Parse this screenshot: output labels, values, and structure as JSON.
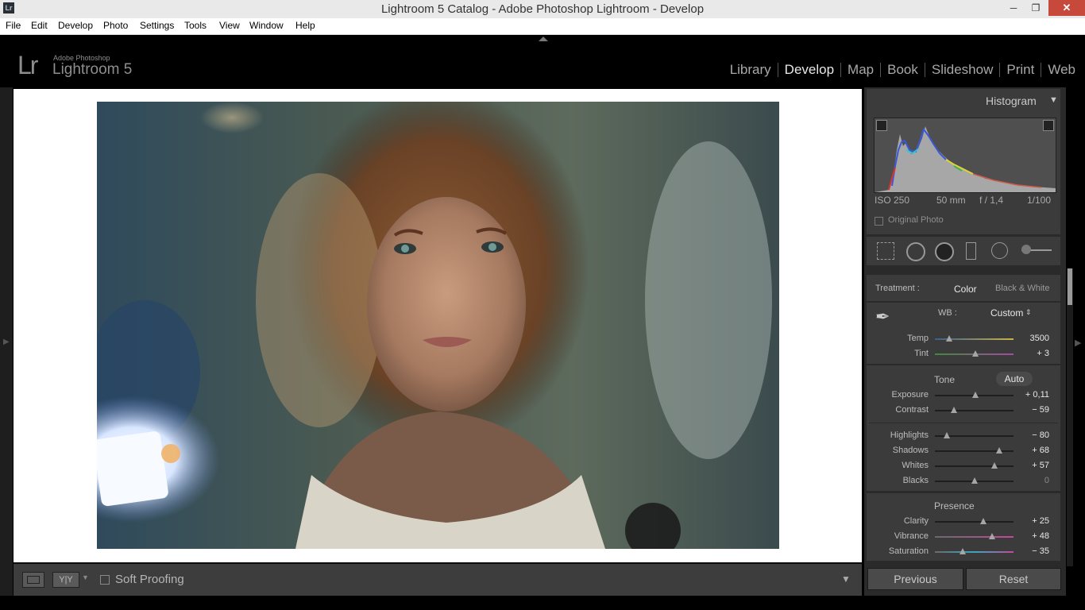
{
  "window": {
    "title": "Lightroom 5 Catalog - Adobe Photoshop Lightroom - Develop",
    "app_icon_text": "Lr",
    "minimize": "─",
    "maximize": "❐",
    "close": "✕"
  },
  "menu": [
    "File",
    "Edit",
    "Develop",
    "Photo",
    "Settings",
    "Tools",
    "View",
    "Window",
    "Help"
  ],
  "brand": {
    "logo": "Lr",
    "small": "Adobe Photoshop",
    "big": "Lightroom 5"
  },
  "modules": [
    {
      "label": "Library",
      "active": false
    },
    {
      "label": "Develop",
      "active": true
    },
    {
      "label": "Map",
      "active": false
    },
    {
      "label": "Book",
      "active": false
    },
    {
      "label": "Slideshow",
      "active": false
    },
    {
      "label": "Print",
      "active": false
    },
    {
      "label": "Web",
      "active": false
    }
  ],
  "histogram": {
    "title": "Histogram",
    "iso": "ISO 250",
    "focal": "50 mm",
    "aperture": "f / 1,4",
    "shutter": "1/100",
    "original_photo": "Original Photo"
  },
  "basic": {
    "treatment_label": "Treatment :",
    "color": "Color",
    "bw": "Black & White",
    "wb_label": "WB :",
    "wb_value": "Custom",
    "tone_label": "Tone",
    "auto": "Auto",
    "presence_label": "Presence"
  },
  "sliders": [
    {
      "name": "temp",
      "label": "Temp",
      "value": "3500",
      "pos": 0.18
    },
    {
      "name": "tint",
      "label": "Tint",
      "value": "+ 3",
      "pos": 0.52
    },
    {
      "name": "exposure",
      "label": "Exposure",
      "value": "+ 0,11",
      "pos": 0.52
    },
    {
      "name": "contrast",
      "label": "Contrast",
      "value": "− 59",
      "pos": 0.24
    },
    {
      "name": "highlights",
      "label": "Highlights",
      "value": "− 80",
      "pos": 0.15
    },
    {
      "name": "shadows",
      "label": "Shadows",
      "value": "+ 68",
      "pos": 0.82
    },
    {
      "name": "whites",
      "label": "Whites",
      "value": "+ 57",
      "pos": 0.76
    },
    {
      "name": "blacks",
      "label": "Blacks",
      "value": "0",
      "pos": 0.5
    },
    {
      "name": "clarity",
      "label": "Clarity",
      "value": "+ 25",
      "pos": 0.62
    },
    {
      "name": "vibrance",
      "label": "Vibrance",
      "value": "+ 48",
      "pos": 0.73
    },
    {
      "name": "saturation",
      "label": "Saturation",
      "value": "− 35",
      "pos": 0.35
    }
  ],
  "toolbar": {
    "soft_proofing": "Soft Proofing",
    "yy": "Y|Y"
  },
  "buttons": {
    "previous": "Previous",
    "reset": "Reset"
  },
  "colors": {
    "panel": "#3b3b3b",
    "accent_text": "#e8e8e8",
    "close": "#c7493b"
  }
}
